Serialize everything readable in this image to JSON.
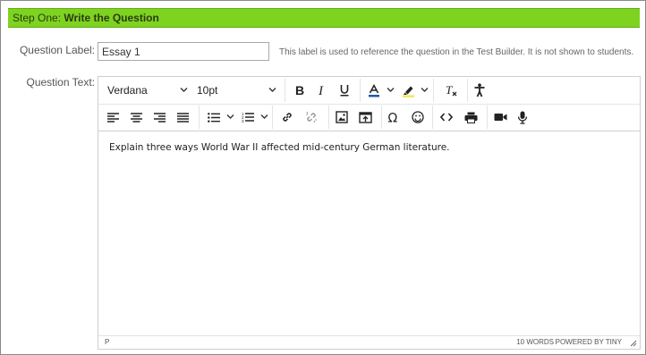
{
  "step": {
    "prefix": "Step One:",
    "title": "Write the Question"
  },
  "question_label": {
    "label": "Question Label:",
    "value": "Essay 1",
    "hint": "This label is used to reference the question in the Test Builder. It is not shown to students."
  },
  "question_text": {
    "label": "Question Text:"
  },
  "toolbar": {
    "font_family": "Verdana",
    "font_size": "10pt"
  },
  "editor": {
    "content": "Explain three ways World War II affected mid-century German literature.",
    "status_path": "P",
    "word_count": "10 WORDS",
    "powered_by": "POWERED BY TINY"
  },
  "colors": {
    "header_bg": "#7ed321",
    "text_color_bar": "#1f57b3",
    "highlight_bar": "#f0e442"
  },
  "icons": [
    "bold-icon",
    "italic-icon",
    "underline-icon",
    "text-color-icon",
    "highlight-icon",
    "clear-format-icon",
    "accessibility-icon",
    "align-left-icon",
    "align-center-icon",
    "align-right-icon",
    "justify-icon",
    "bullet-list-icon",
    "numbered-list-icon",
    "link-icon",
    "unlink-icon",
    "image-icon",
    "upload-icon",
    "omega-icon",
    "emoji-icon",
    "code-icon",
    "print-icon",
    "video-icon",
    "microphone-icon",
    "resize-handle-icon"
  ]
}
